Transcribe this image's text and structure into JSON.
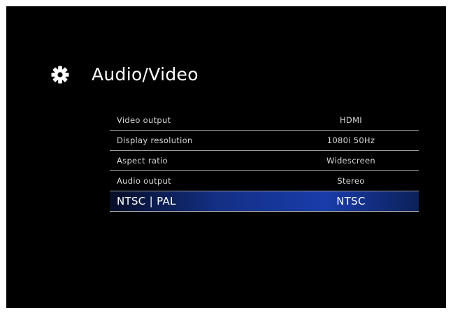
{
  "screen": {
    "title": "Audio/Video",
    "icon": "gear-icon"
  },
  "menu": {
    "items": [
      {
        "label": "Video output",
        "value": "HDMI"
      },
      {
        "label": "Display resolution",
        "value": "1080i 50Hz"
      },
      {
        "label": "Aspect ratio",
        "value": "Widescreen"
      },
      {
        "label": "Audio output",
        "value": "Stereo"
      },
      {
        "label": "NTSC | PAL",
        "value": "NTSC",
        "selected": true
      }
    ]
  },
  "colors": {
    "background": "#000000",
    "text": "#ffffff",
    "selection_highlight": "#1e3ca8"
  }
}
